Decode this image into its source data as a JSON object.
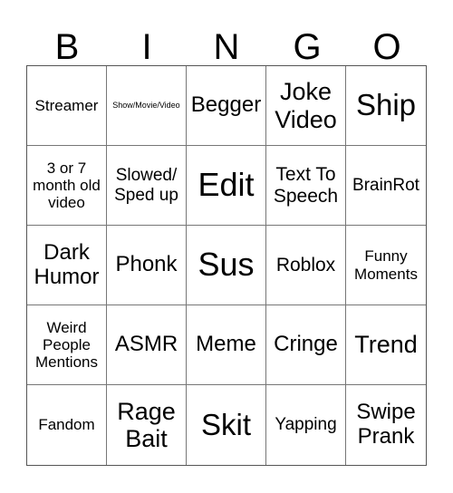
{
  "header": {
    "letters": [
      "B",
      "I",
      "N",
      "G",
      "O"
    ]
  },
  "grid": {
    "rows": [
      [
        "Streamer",
        "Show/Movie/Video",
        "Begger",
        "Joke Video",
        "Ship"
      ],
      [
        "3 or 7 month old video",
        "Slowed/ Sped up",
        "Edit",
        "Text To Speech",
        "BrainRot"
      ],
      [
        "Dark Humor",
        "Phonk",
        "Sus",
        "Roblox",
        "Funny Moments"
      ],
      [
        "Weird People Mentions",
        "ASMR",
        "Meme",
        "Cringe",
        "Trend"
      ],
      [
        "Fandom",
        "Rage Bait",
        "Skit",
        "Yapping",
        "Swipe Prank"
      ]
    ]
  }
}
